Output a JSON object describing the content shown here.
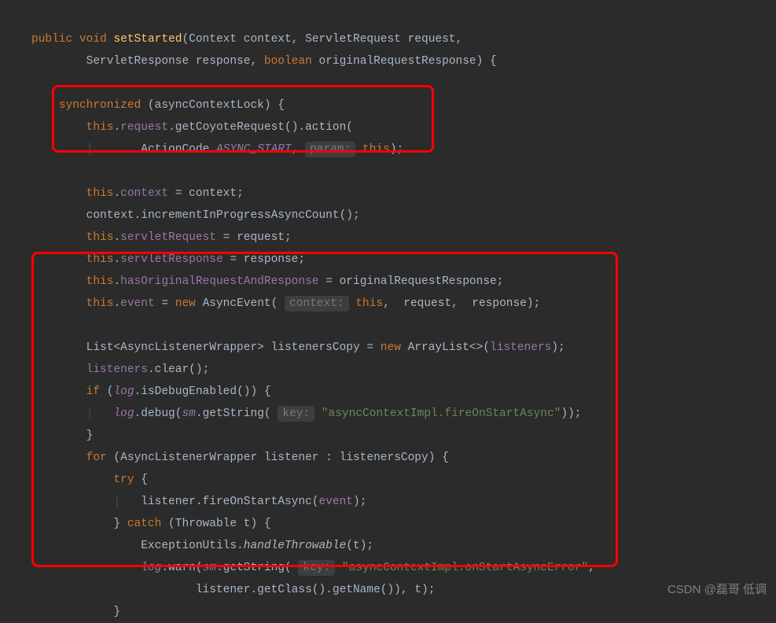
{
  "code": {
    "line1_public": "public",
    "line1_void": "void",
    "line1_method": "setStarted",
    "line1_params": "(Context context, ServletRequest request,",
    "line2": "ServletResponse response, ",
    "line2_boolean": "boolean",
    "line2_rest": " originalRequestResponse) {",
    "line3_sync": "synchronized",
    "line3_rest": " (asyncContextLock) {",
    "line4_this": "this",
    "line4_dot": ".",
    "line4_request": "request",
    "line4_rest": ".getCoyoteRequest().action(",
    "line5_pre": "ActionCode.",
    "line5_async": "ASYNC_START",
    "line5_comma": ", ",
    "line5_hint": "param:",
    "line5_this": " this",
    "line5_end": ");",
    "line6_this": "this",
    "line6_dot": ".",
    "line6_context": "context",
    "line6_rest": " = context;",
    "line7": "context.incrementInProgressAsyncCount();",
    "line8_this": "this",
    "line8_dot": ".",
    "line8_sr": "servletRequest",
    "line8_rest": " = request;",
    "line9_this": "this",
    "line9_dot": ".",
    "line9_sr": "servletResponse",
    "line9_rest": " = response;",
    "line10_this": "this",
    "line10_dot": ".",
    "line10_has": "hasOriginalRequestAndResponse",
    "line10_rest": " = originalRequestResponse;",
    "line11_this": "this",
    "line11_dot": ".",
    "line11_event": "event",
    "line11_eq": " = ",
    "line11_new": "new",
    "line11_ae": " AsyncEvent( ",
    "line11_hint": "context:",
    "line11_this2": " this",
    "line11_rest": ",  request,  response);",
    "line12_pre": "List<AsyncListenerWrapper> listenersCopy = ",
    "line12_new": "new",
    "line12_al": " ArrayList<>(",
    "line12_listeners": "listeners",
    "line12_end": ");",
    "line13_listeners": "listeners",
    "line13_rest": ".clear();",
    "line14_if": "if",
    "line14_open": " (",
    "line14_log": "log",
    "line14_rest": ".isDebugEnabled()) {",
    "line15_log": "log",
    "line15_debug": ".debug(",
    "line15_sm": "sm",
    "line15_gs": ".getString( ",
    "line15_hint": "key:",
    "line15_str": " \"asyncContextImpl.fireOnStartAsync\"",
    "line15_end": "));",
    "line16": "}",
    "line17_for": "for",
    "line17_rest": " (AsyncListenerWrapper listener : listenersCopy) {",
    "line18_try": "try",
    "line18_rest": " {",
    "line19_pre": "listener.fireOnStartAsync(",
    "line19_event": "event",
    "line19_end": ");",
    "line20_close": "} ",
    "line20_catch": "catch",
    "line20_rest": " (Throwable t) {",
    "line21_pre": "ExceptionUtils.",
    "line21_ht": "handleThrowable",
    "line21_rest": "(t);",
    "line22_log": "log",
    "line22_warn": ".warn(",
    "line22_sm": "sm",
    "line22_gs": ".getString( ",
    "line22_hint": "key:",
    "line22_str": " \"asyncContextImpl.onStartAsyncError\"",
    "line22_end": ",",
    "line23": "listener.getClass().getName()), t);",
    "line24": "}"
  },
  "watermark": "CSDN @磊哥 低调"
}
